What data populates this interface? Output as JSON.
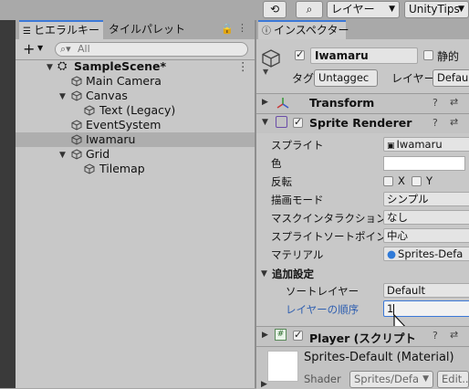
{
  "toolbar": {
    "history_icon": "history-icon",
    "search_icon": "search-icon",
    "layers_label": "レイヤー",
    "layout_label": "UnityTips"
  },
  "hierarchy": {
    "tab_label": "ヒエラルキー",
    "tile_palette_tab": "タイルパレット",
    "add_label": "+",
    "search_placeholder": "All",
    "items": [
      {
        "label": "SampleScene*"
      },
      {
        "label": "Main Camera"
      },
      {
        "label": "Canvas"
      },
      {
        "label": "Text (Legacy)"
      },
      {
        "label": "EventSystem"
      },
      {
        "label": "Iwamaru"
      },
      {
        "label": "Grid"
      },
      {
        "label": "Tilemap"
      }
    ]
  },
  "inspector": {
    "tab_label": "インスペクター",
    "object_name": "Iwamaru",
    "static_label": "静的",
    "tag_label": "タグ",
    "tag_value": "Untaggec",
    "layer_label": "レイヤー",
    "layer_value": "Defau",
    "transform_title": "Transform",
    "sprite_renderer_title": "Sprite Renderer",
    "props": {
      "sprite_label": "スプライト",
      "sprite_value": "Iwamaru",
      "color_label": "色",
      "flip_label": "反転",
      "flip_x": "X",
      "flip_y": "Y",
      "draw_mode_label": "描画モード",
      "draw_mode_value": "シンプル",
      "mask_label": "マスクインタラクション",
      "mask_value": "なし",
      "sort_point_label": "スプライトソートポイント",
      "sort_point_value": "中心",
      "material_label": "マテリアル",
      "material_value": "Sprites-Defa"
    },
    "additional_settings": "追加設定",
    "sorting_layer_label": "ソートレイヤー",
    "sorting_layer_value": "Default",
    "order_label": "レイヤーの順序",
    "order_value": "1",
    "player_title": "Player (スクリプト",
    "material_title": "Sprites-Default (Material)",
    "shader_label": "Shader",
    "shader_value": "Sprites/Defa",
    "edit_label": "Edit..."
  },
  "colors": {
    "accent": "#3b78d8",
    "link_blue": "#2f5fb0",
    "panel": "#c8c8c8",
    "dark": "#3a3a3a"
  }
}
